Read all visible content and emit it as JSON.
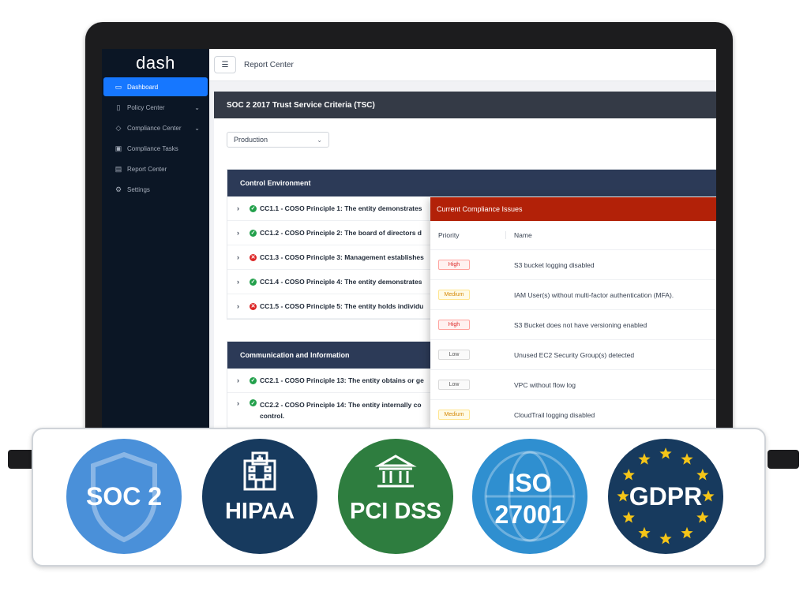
{
  "app": {
    "logo": "dash",
    "sidebar": [
      {
        "label": "Dashboard",
        "icon": "monitor-icon",
        "active": true,
        "has_chevron": false
      },
      {
        "label": "Policy Center",
        "icon": "document-icon",
        "active": false,
        "has_chevron": true
      },
      {
        "label": "Compliance Center",
        "icon": "shield-icon",
        "active": false,
        "has_chevron": true
      },
      {
        "label": "Compliance Tasks",
        "icon": "calendar-icon",
        "active": false,
        "has_chevron": false
      },
      {
        "label": "Report Center",
        "icon": "folder-icon",
        "active": false,
        "has_chevron": false
      },
      {
        "label": "Settings",
        "icon": "gear-icon",
        "active": false,
        "has_chevron": false
      }
    ],
    "header": {
      "title": "Report Center"
    },
    "criteria_title": "SOC 2 2017 Trust Service Criteria (TSC)",
    "environment_select": {
      "value": "Production"
    },
    "sections": [
      {
        "title": "Control Environment",
        "controls": [
          {
            "status": "pass",
            "text": "CC1.1 - COSO Principle 1: The entity demonstrates"
          },
          {
            "status": "pass",
            "text": "CC1.2 - COSO Principle 2: The board of directors d"
          },
          {
            "status": "fail",
            "text": "CC1.3 - COSO Principle 3: Management establishes"
          },
          {
            "status": "pass",
            "text": "CC1.4 - COSO Principle 4: The entity demonstrates"
          },
          {
            "status": "fail",
            "text": "CC1.5 - COSO Principle 5: The entity holds individu"
          }
        ]
      },
      {
        "title": "Communication and Information",
        "controls": [
          {
            "status": "pass",
            "text": "CC2.1 - COSO Principle 13: The entity obtains or ge"
          },
          {
            "status": "pass",
            "text": "CC2.2 - COSO Principle 14: The entity internally co control."
          }
        ]
      }
    ],
    "issues_panel": {
      "title": "Current Compliance Issues",
      "columns": [
        "Priority",
        "Name"
      ],
      "rows": [
        {
          "priority": "High",
          "name": "S3 bucket logging disabled"
        },
        {
          "priority": "Medium",
          "name": "IAM User(s) without multi-factor authentication (MFA)."
        },
        {
          "priority": "High",
          "name": "S3 Bucket does not have versioning enabled"
        },
        {
          "priority": "Low",
          "name": "Unused EC2 Security Group(s) detected"
        },
        {
          "priority": "Low",
          "name": "VPC without flow log"
        },
        {
          "priority": "Medium",
          "name": "CloudTrail logging disabled"
        }
      ]
    }
  },
  "badges": [
    {
      "lines": [
        "SOC 2"
      ],
      "icon": "shield-icon",
      "color": "#4a90d9"
    },
    {
      "lines": [
        "HIPAA"
      ],
      "icon": "hospital-icon",
      "color": "#173a5e"
    },
    {
      "lines": [
        "PCI DSS"
      ],
      "icon": "bank-icon",
      "color": "#2e7d3f"
    },
    {
      "lines": [
        "ISO",
        "27001"
      ],
      "icon": "globe-icon",
      "color": "#2f8fd0"
    },
    {
      "lines": [
        "GDPR"
      ],
      "icon": "eu-stars-icon",
      "color": "#173a5e",
      "star_color": "#f5c518"
    }
  ]
}
